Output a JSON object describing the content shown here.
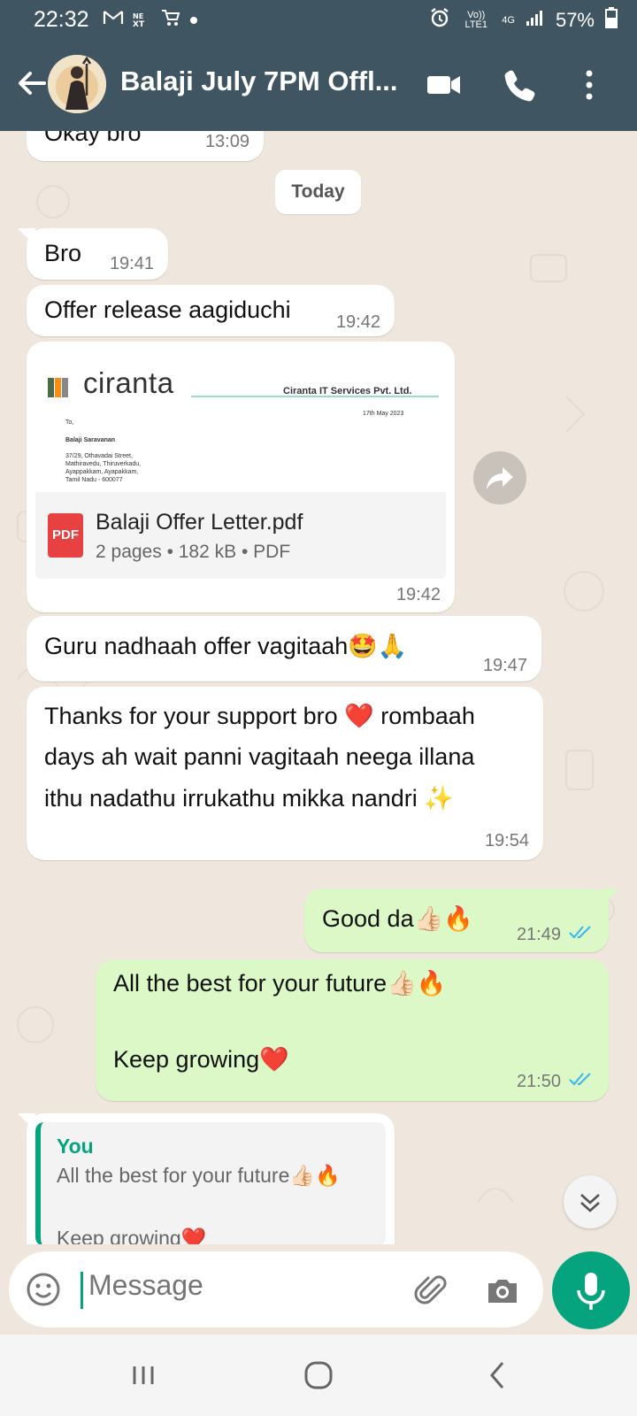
{
  "status_bar": {
    "time": "22:32",
    "left_icons": [
      "gmail-icon",
      "news-icon",
      "cart-icon",
      "dot-icon"
    ],
    "volte": "Vo)) LTE1",
    "network": "4G",
    "battery": "57%"
  },
  "header": {
    "title": "Balaji July 7PM Offl...",
    "actions": [
      "video-call-icon",
      "phone-icon",
      "more-options-icon"
    ]
  },
  "chat": {
    "date_chip": "Today",
    "messages": [
      {
        "dir": "in",
        "text": "Okay bro",
        "time": "13:09"
      },
      {
        "dir": "in",
        "text": "Bro",
        "time": "19:41"
      },
      {
        "dir": "in",
        "text": "Offer release aagiduchi",
        "time": "19:42"
      },
      {
        "dir": "in",
        "type": "document",
        "preview": {
          "company_logo": "ciranta",
          "company_name": "Ciranta IT Services Pvt. Ltd.",
          "date": "17th May 2023",
          "to": "To,",
          "recipient": "Balaji Saravanan",
          "address_lines": [
            "37/29, Othavadai Street,",
            "Mathiravedu, Thiruverkadu,",
            "Ayappakkam, Ayapakkam,",
            "Tamil Nadu - 600077"
          ]
        },
        "file_name": "Balaji Offer Letter.pdf",
        "file_info": "2 pages • 182 kB • PDF",
        "pdf_badge": "PDF",
        "time": "19:42"
      },
      {
        "dir": "in",
        "text": "Guru nadhaah offer vagitaah🤩🙏",
        "time": "19:47"
      },
      {
        "dir": "in",
        "text": "Thanks for your support bro ❤️ rombaah\ndays ah wait panni vagitaah neega illana\nithu nadathu irrukathu mikka nandri ✨",
        "time": "19:54"
      },
      {
        "dir": "out",
        "text": "Good da👍🏻🔥",
        "time": "21:49",
        "read": true
      },
      {
        "dir": "out",
        "text": "All the best for your future👍🏻🔥\n\nKeep growing❤️",
        "time": "21:50",
        "read": true
      },
      {
        "dir": "in",
        "type": "reply",
        "quoted_sender": "You",
        "quoted_text": "All the best for your future👍🏻🔥\n\nKeep growing❤️"
      }
    ]
  },
  "composer": {
    "placeholder": "Message"
  },
  "colors": {
    "header": "#3f5561",
    "accent": "#06a47e",
    "outgoing_bubble": "#dcf8c6",
    "wallpaper": "#efe7dd",
    "read_ticks": "#34b7f1"
  }
}
